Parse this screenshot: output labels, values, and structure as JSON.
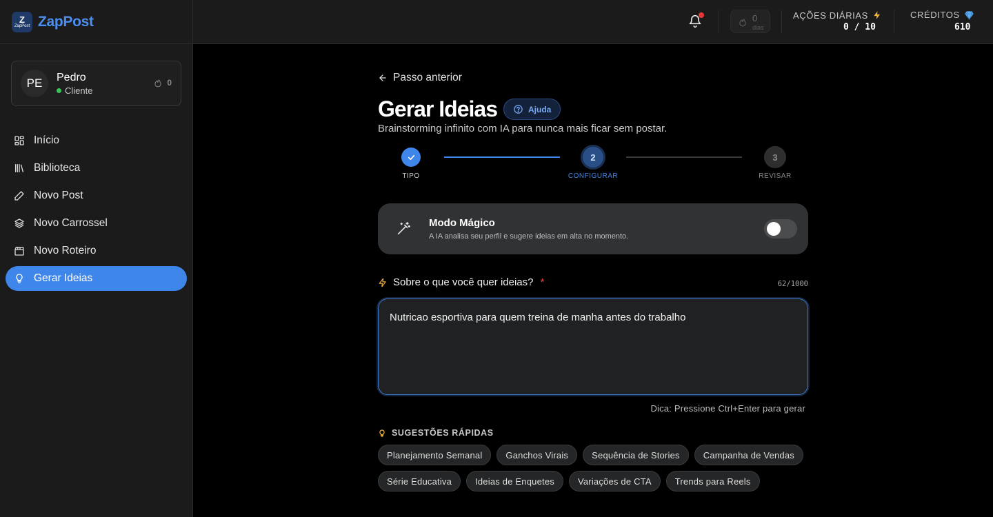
{
  "brand": {
    "logo_glyph": "Z",
    "logo_small": "ZapPost",
    "name": "ZapPost",
    "accent": "#4d8ff0"
  },
  "user": {
    "initials": "PE",
    "name": "Pedro",
    "role": "Cliente",
    "streak": "0"
  },
  "nav": {
    "items": [
      {
        "label": "Início",
        "icon": "grid-icon"
      },
      {
        "label": "Biblioteca",
        "icon": "library-icon"
      },
      {
        "label": "Novo Post",
        "icon": "pencil-icon"
      },
      {
        "label": "Novo Carrossel",
        "icon": "layers-icon"
      },
      {
        "label": "Novo Roteiro",
        "icon": "clapperboard-icon"
      },
      {
        "label": "Gerar Ideias",
        "icon": "lightbulb-icon",
        "active": true
      }
    ]
  },
  "topbar": {
    "streak_days": "0",
    "streak_label": "dias",
    "daily_actions_label": "AÇÕES DIÁRIAS",
    "daily_actions_value": "0 / 10",
    "credits_label": "CRÉDITOS",
    "credits_value": "610"
  },
  "page": {
    "back_label": "Passo anterior",
    "title": "Gerar Ideias",
    "help_label": "Ajuda",
    "subtitle": "Brainstorming infinito com IA para nunca mais ficar sem postar."
  },
  "stepper": {
    "steps": [
      {
        "label": "TIPO",
        "number": "",
        "state": "done"
      },
      {
        "label": "CONFIGURAR",
        "number": "2",
        "state": "current"
      },
      {
        "label": "REVISAR",
        "number": "3",
        "state": "upcoming"
      }
    ]
  },
  "magic_mode": {
    "title": "Modo Mágico",
    "description": "A IA analisa seu perfil e sugere ideias em alta no momento.",
    "enabled": false
  },
  "prompt": {
    "label": "Sobre o que você quer ideias?",
    "required_mark": "*",
    "counter": "62/1000",
    "value": "Nutricao esportiva para quem treina de manha antes do trabalho",
    "hint": "Dica: Pressione Ctrl+Enter para gerar"
  },
  "suggestions": {
    "heading": "SUGESTÕES RÁPIDAS",
    "chips": [
      "Planejamento Semanal",
      "Ganchos Virais",
      "Sequência de Stories",
      "Campanha de Vendas",
      "Série Educativa",
      "Ideias de Enquetes",
      "Variações de CTA",
      "Trends para Reels"
    ]
  },
  "colors": {
    "primary": "#3f86ea",
    "success": "#3bc45a",
    "danger": "#e04444",
    "warning": "#f5b73b",
    "diamond": "#5fb0f5"
  }
}
